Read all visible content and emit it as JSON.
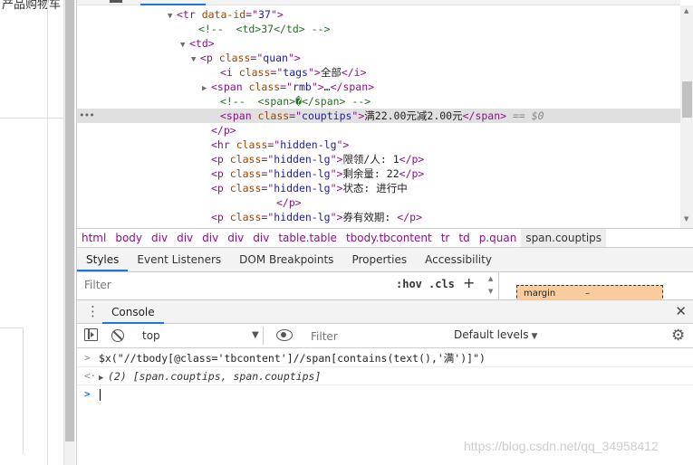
{
  "page": {
    "top_text": "产品购物车"
  },
  "tree": {
    "lines": [
      {
        "tri": "▼",
        "parts": [
          [
            "tag",
            "<tr "
          ],
          [
            "attr",
            "data-id"
          ],
          [
            "tag",
            "=\""
          ],
          [
            "val",
            "37"
          ],
          [
            "tag",
            "\">"
          ]
        ]
      },
      {
        "tri": "",
        "parts": [
          [
            "cmt",
            "<!--  <td>37</td> -->"
          ]
        ]
      },
      {
        "tri": "▼",
        "parts": [
          [
            "tag",
            "<td>"
          ]
        ]
      },
      {
        "tri": "▼",
        "parts": [
          [
            "tag",
            "<p "
          ],
          [
            "attr",
            "class"
          ],
          [
            "tag",
            "=\""
          ],
          [
            "val",
            "quan"
          ],
          [
            "tag",
            "\">"
          ]
        ]
      },
      {
        "tri": "",
        "parts": [
          [
            "tag",
            "<i "
          ],
          [
            "attr",
            "class"
          ],
          [
            "tag",
            "=\""
          ],
          [
            "val",
            "tags"
          ],
          [
            "tag",
            "\">"
          ],
          [
            "txt",
            "全部"
          ],
          [
            "tag",
            "</i>"
          ]
        ]
      },
      {
        "tri": "▶",
        "parts": [
          [
            "tag",
            "<span "
          ],
          [
            "attr",
            "class"
          ],
          [
            "tag",
            "=\""
          ],
          [
            "val",
            "rmb"
          ],
          [
            "tag",
            "\">"
          ],
          [
            "txt",
            "…"
          ],
          [
            "tag",
            "</span>"
          ]
        ]
      },
      {
        "tri": "",
        "parts": [
          [
            "cmt",
            "<!--  <span>�</span> -->"
          ]
        ]
      },
      {
        "tri": "",
        "parts": [
          [
            "tag",
            "<span "
          ],
          [
            "attr",
            "class"
          ],
          [
            "tag",
            "=\""
          ],
          [
            "val",
            "couptips"
          ],
          [
            "tag",
            "\">"
          ],
          [
            "txt",
            "满22.00元减2.00元"
          ],
          [
            "tag",
            "</span>"
          ],
          [
            "eq0",
            " == $0"
          ]
        ]
      },
      {
        "tri": "",
        "parts": [
          [
            "tag",
            "</p>"
          ]
        ]
      },
      {
        "tri": "",
        "parts": [
          [
            "tag",
            "<hr "
          ],
          [
            "attr",
            "class"
          ],
          [
            "tag",
            "=\""
          ],
          [
            "val",
            "hidden-lg"
          ],
          [
            "tag",
            "\">"
          ]
        ]
      },
      {
        "tri": "",
        "parts": [
          [
            "tag",
            "<p "
          ],
          [
            "attr",
            "class"
          ],
          [
            "tag",
            "=\""
          ],
          [
            "val",
            "hidden-lg"
          ],
          [
            "tag",
            "\">"
          ],
          [
            "txt",
            "限领/人: 1"
          ],
          [
            "tag",
            "</p>"
          ]
        ]
      },
      {
        "tri": "",
        "parts": [
          [
            "tag",
            "<p "
          ],
          [
            "attr",
            "class"
          ],
          [
            "tag",
            "=\""
          ],
          [
            "val",
            "hidden-lg"
          ],
          [
            "tag",
            "\">"
          ],
          [
            "txt",
            "剩余量: 22"
          ],
          [
            "tag",
            "</p>"
          ]
        ]
      },
      {
        "tri": "",
        "parts": [
          [
            "tag",
            "<p "
          ],
          [
            "attr",
            "class"
          ],
          [
            "tag",
            "=\""
          ],
          [
            "val",
            "hidden-lg"
          ],
          [
            "tag",
            "\">"
          ],
          [
            "txt",
            "状态: 进行中"
          ]
        ]
      },
      {
        "tri": "",
        "parts": [
          [
            "tag",
            "</p>"
          ]
        ]
      },
      {
        "tri": "",
        "parts": [
          [
            "tag",
            "<p "
          ],
          [
            "attr",
            "class"
          ],
          [
            "tag",
            "=\""
          ],
          [
            "val",
            "hidden-lg"
          ],
          [
            "tag",
            "\">"
          ],
          [
            "txt",
            "券有效期: "
          ],
          [
            "tag",
            "</p>"
          ]
        ]
      }
    ],
    "selected_dots": "•••"
  },
  "breadcrumbs": [
    "html",
    "body",
    "div",
    "div",
    "div",
    "div",
    "div",
    "table.table",
    "tbody.tbcontent",
    "tr",
    "td",
    "p.quan",
    "span.couptips"
  ],
  "styles_tabs": [
    "Styles",
    "Event Listeners",
    "DOM Breakpoints",
    "Properties",
    "Accessibility"
  ],
  "styles_filter": {
    "placeholder": "Filter"
  },
  "hov_label": ":hov",
  "cls_label": ".cls",
  "plus_label": "+",
  "box_model": {
    "label": "margin",
    "dash": "–"
  },
  "console": {
    "menu_glyph": "⋮",
    "tab_label": "Console",
    "close_glyph": "✕",
    "context": "top",
    "filter_placeholder": "Filter",
    "levels_label": "Default levels",
    "levels_arrow": "▼",
    "context_arrow": "▼",
    "gear_glyph": "⚙",
    "command_gutter": ">",
    "command": "$x(\"//tbody[@class='tbcontent']//span[contains(text(),'满')]\")",
    "result_gutter": "<·",
    "result_tri": "▶",
    "result": "(2) [span.couptips, span.couptips]",
    "prompt_gutter": ">"
  },
  "watermark": "https://blog.csdn.net/qq_34958412"
}
